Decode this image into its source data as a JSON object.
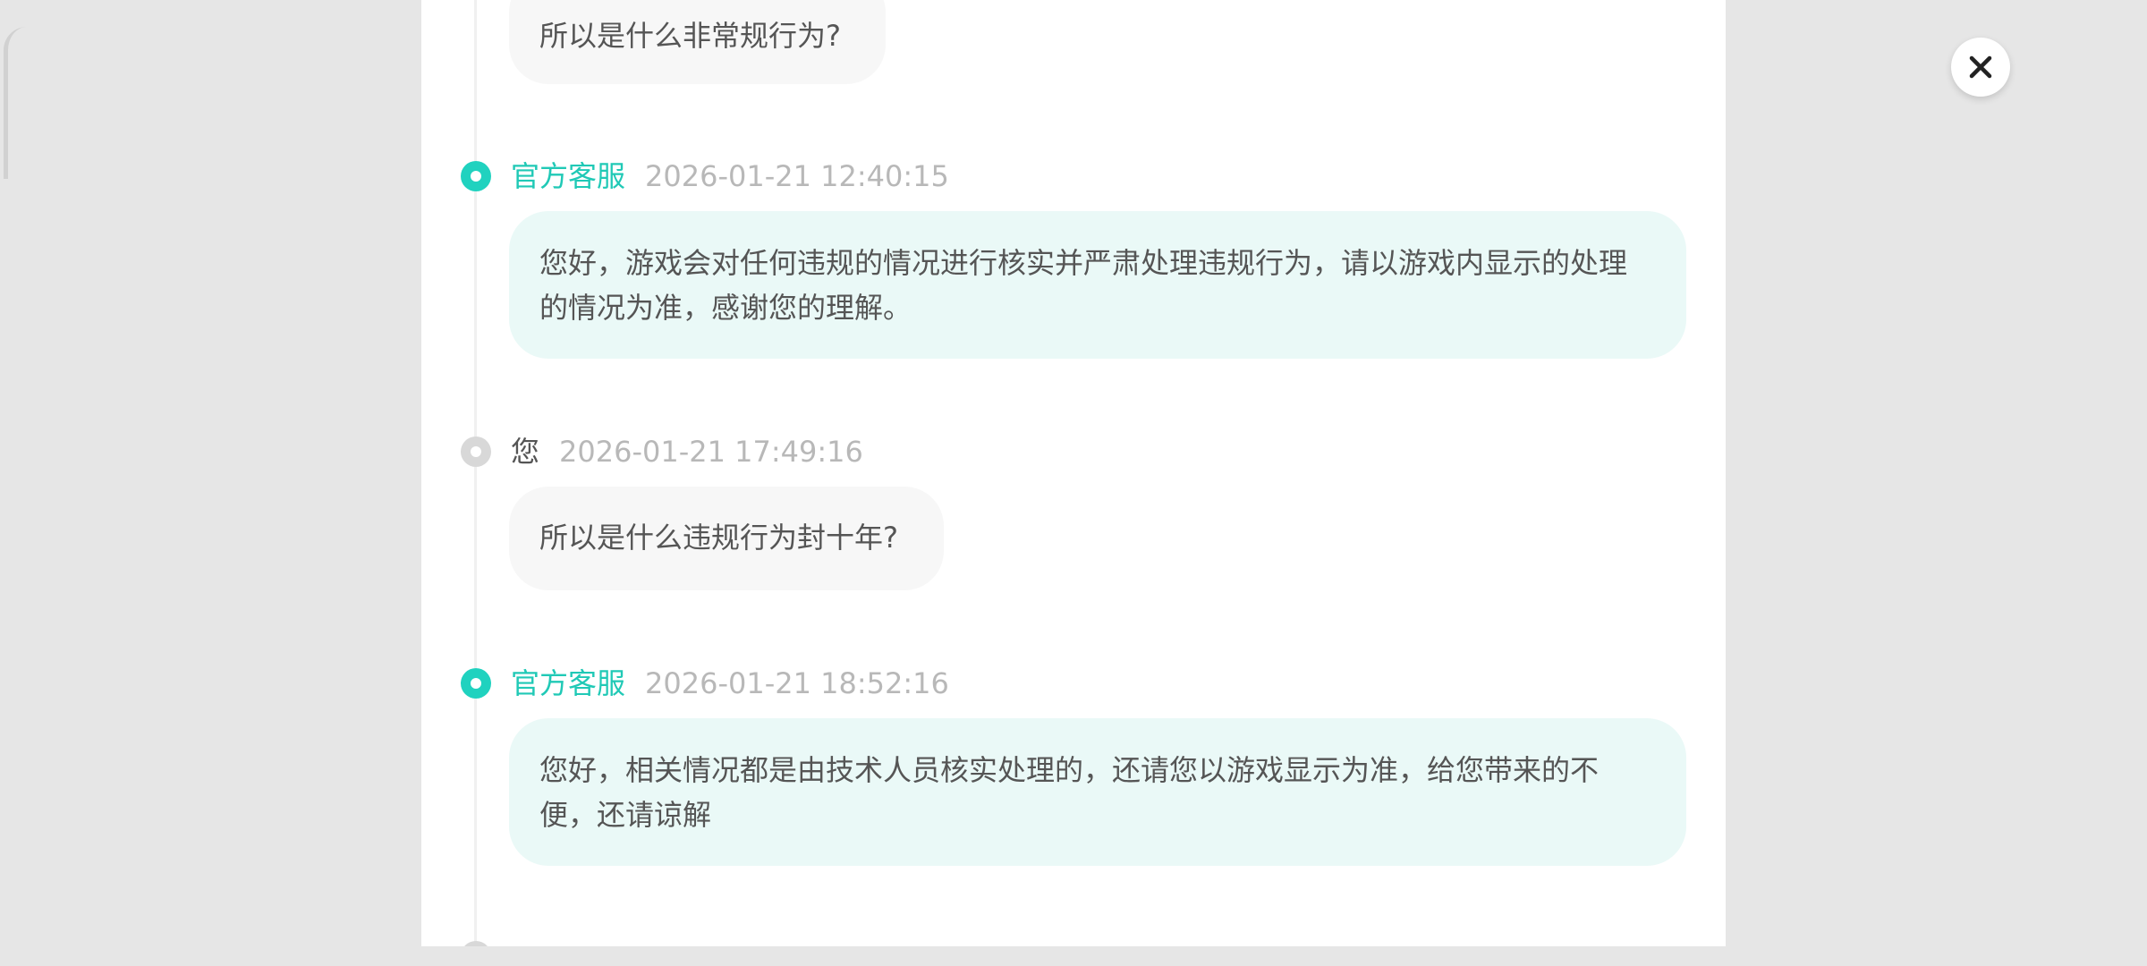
{
  "colors": {
    "agent_accent": "#20d2bf",
    "agent_bubble": "#eaf9f7",
    "user_dot": "#d8d8d8",
    "user_bubble": "#f7f7f7",
    "backdrop": "#e6e6e6"
  },
  "close_button": {
    "icon": "close-icon"
  },
  "messages": [
    {
      "role": "user",
      "text": "所以是什么非常规行为?"
    },
    {
      "role": "agent",
      "sender": "官方客服",
      "time": "2026-01-21 12:40:15",
      "lines": [
        "您好，游戏会对任何违规的情况进行核实并严肃处理违规行为，请以游戏内显示的处理",
        "的情况为准，感谢您的理解。"
      ]
    },
    {
      "role": "user",
      "sender": "您",
      "time": "2026-01-21 17:49:16",
      "text": "所以是什么违规行为封十年?"
    },
    {
      "role": "agent",
      "sender": "官方客服",
      "time": "2026-01-21 18:52:16",
      "lines": [
        "您好，相关情况都是由技术人员核实处理的，还请您以游戏显示为准，给您带来的不",
        "便，还请谅解"
      ]
    }
  ]
}
